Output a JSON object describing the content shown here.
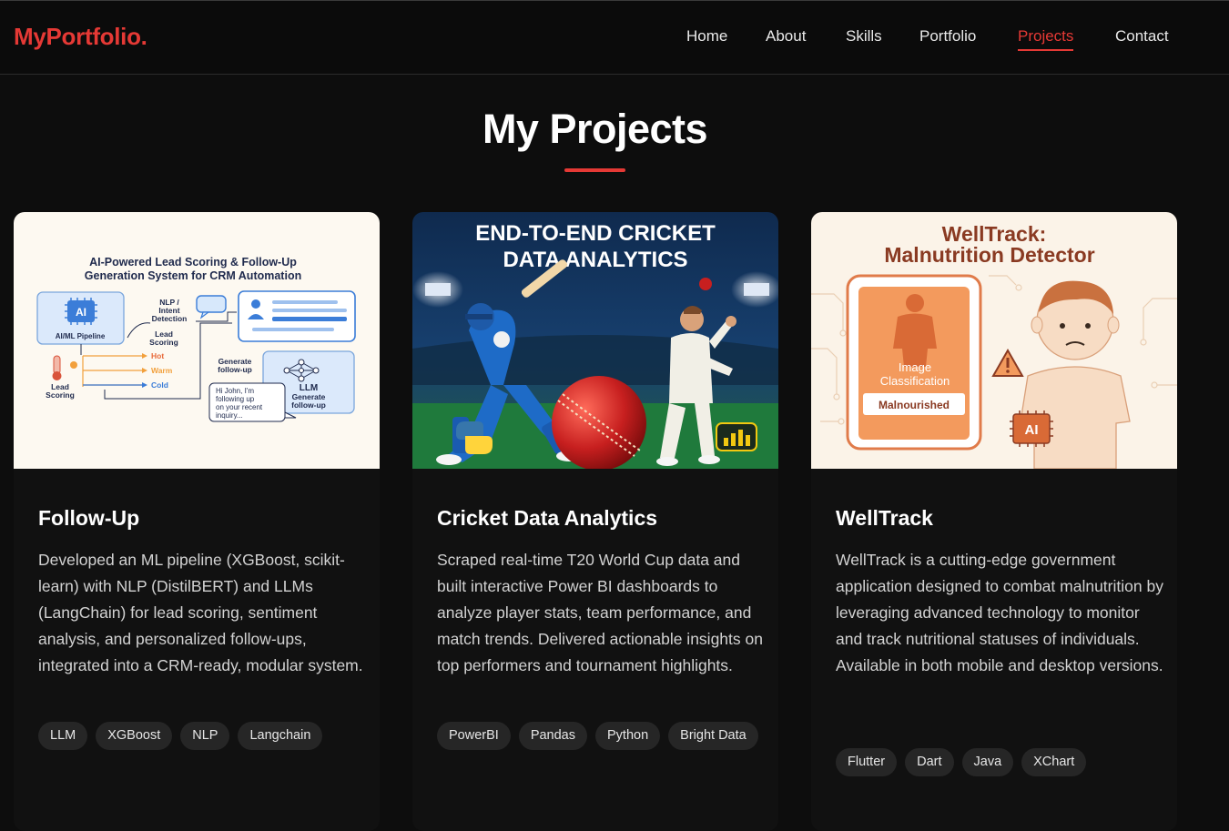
{
  "header": {
    "logo": "MyPortfolio.",
    "nav": [
      {
        "label": "Home",
        "active": false
      },
      {
        "label": "About",
        "active": false
      },
      {
        "label": "Skills",
        "active": false
      },
      {
        "label": "Portfolio",
        "active": false
      },
      {
        "label": "Projects",
        "active": true
      },
      {
        "label": "Contact",
        "active": false
      }
    ]
  },
  "section": {
    "title": "My Projects"
  },
  "colors": {
    "accent": "#e53935",
    "background": "#0d0d0d",
    "card": "#111111",
    "tag": "#262626"
  },
  "projects": [
    {
      "title": "Follow-Up",
      "description": "Developed an ML pipeline (XGBoost, scikit-learn) with NLP (DistilBERT) and LLMs (LangChain) for lead scoring, sentiment analysis, and personalized follow-ups, integrated into a CRM-ready, modular system.",
      "tags": [
        "LLM",
        "XGBoost",
        "NLP",
        "Langchain"
      ],
      "image": {
        "title_line1": "AI-Powered Lead Scoring & Follow-Up",
        "title_line2": "Generation System for CRM Automation",
        "ai_label": "AI",
        "pipeline_label": "AI/ML Pipeline",
        "nlp_label_1": "NLP /",
        "nlp_label_2": "Intent",
        "nlp_label_3": "Detection",
        "lead_scoring_1": "Lead",
        "lead_scoring_2": "Scoring",
        "lead_scoring_bottom_1": "Lead",
        "lead_scoring_bottom_2": "Scoring",
        "hot": "Hot",
        "warm": "Warm",
        "cold": "Cold",
        "generate_1": "Generate",
        "generate_2": "follow-up",
        "llm_1": "LLM",
        "llm_2": "Generate",
        "llm_3": "follow-up",
        "bubble_1": "Hi John, I'm",
        "bubble_2": "following up",
        "bubble_3": "on your recent",
        "bubble_4": "inquiry..."
      }
    },
    {
      "title": "Cricket Data Analytics",
      "description": "Scraped real-time T20 World Cup data and built interactive Power BI dashboards to analyze player stats, team performance, and match trends. Delivered actionable insights on top performers and tournament highlights.",
      "tags": [
        "PowerBI",
        "Pandas",
        "Python",
        "Bright Data"
      ],
      "image": {
        "line1": "END-TO-END CRICKET",
        "line2": "DATA ANALYTICS"
      }
    },
    {
      "title": "WellTrack",
      "description": "WellTrack is a cutting-edge government application designed to combat malnutrition by leveraging advanced technology to monitor and track nutritional statuses of individuals. Available in both mobile and desktop versions.",
      "tags": [
        "Flutter",
        "Dart",
        "Java",
        "XChart"
      ],
      "image": {
        "line1": "WellTrack:",
        "line2": "Malnutrition Detector",
        "classification_1": "Image",
        "classification_2": "Classification",
        "result": "Malnourished",
        "ai_chip": "AI"
      }
    }
  ]
}
